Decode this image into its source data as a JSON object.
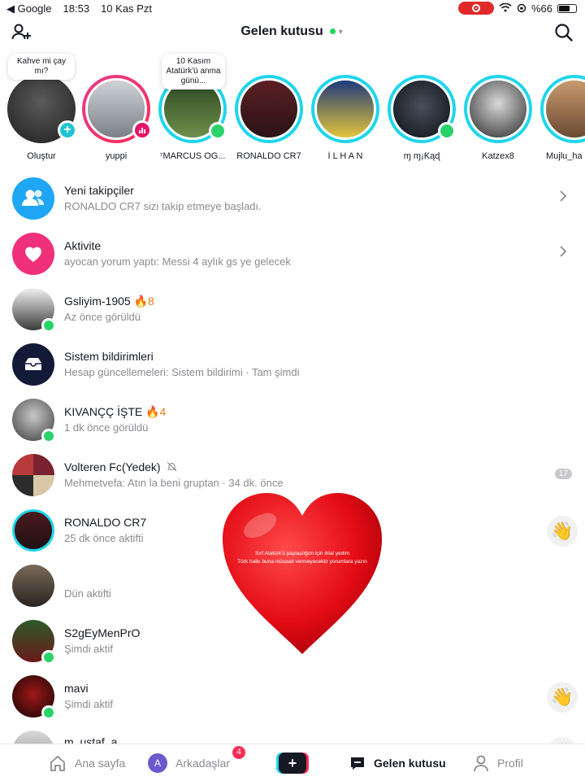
{
  "status_bar": {
    "back_app": "◀ Google",
    "time": "18:53",
    "date": "10 Kas Pzt",
    "battery_percent": "%66",
    "battery_level": 0.66
  },
  "header": {
    "title": "Gelen kutusu"
  },
  "stories": [
    {
      "name": "Oluştur",
      "bubble": "Kahve mi çay mı?",
      "badge": "plus",
      "ring": "none"
    },
    {
      "name": "yuppi",
      "badge": "music",
      "ring": "pink"
    },
    {
      "name": "⁷MARCUS OG...",
      "bubble": "10 Kasım Atatürk'ü anma günü...",
      "badge": "online",
      "ring": "cyan"
    },
    {
      "name": "RONALDO CR7",
      "ring": "cyan"
    },
    {
      "name": "İ L H A N",
      "ring": "cyan"
    },
    {
      "name": "ɱ ɱ¡Ƙąɖ",
      "badge": "online",
      "ring": "cyan"
    },
    {
      "name": "Katzex8",
      "ring": "cyan"
    },
    {
      "name": "Mujlu_ha",
      "ring": "cyan"
    }
  ],
  "messages": [
    {
      "title": "Yeni takipçiler",
      "subtitle": "RONALDO CR7 sizi takip etmeye başladı.",
      "icon": "users-icon",
      "trailing": "chevron"
    },
    {
      "title": "Aktivite",
      "subtitle": "ayocan yorum yaptı: Messi 4 aylık gs ye gelecek",
      "icon": "heart-icon",
      "trailing": "chevron"
    },
    {
      "title": "Gsliyim-1905",
      "streak": "8",
      "subtitle": "Az önce görüldü",
      "online": true
    },
    {
      "title": "Sistem bildirimleri",
      "subtitle": "Hesap güncellemeleri: Sistem bildirimi · Tam şimdi",
      "icon": "inbox-icon"
    },
    {
      "title": "KIVANÇÇ İŞTE",
      "streak": "4",
      "subtitle": "1 dk önce görüldü",
      "online": true
    },
    {
      "title": "Volteren Fc(Yedek)",
      "muted": true,
      "subtitle": "Mehmetvefa: Atın la beni gruptan · 34 dk. önce",
      "count": "17"
    },
    {
      "title": "RONALDO CR7",
      "subtitle": "25 dk önce aktifti",
      "trailing": "wave"
    },
    {
      "title": "",
      "subtitle": "Dün aktifti"
    },
    {
      "title": "S2gEyMenPrO",
      "subtitle": "Şimdi aktif",
      "online": true
    },
    {
      "title": "mavi",
      "subtitle": "Şimdi aktif",
      "online": true,
      "trailing": "wave"
    },
    {
      "title": "m_ustaf_a",
      "subtitle": "",
      "trailing": "wave"
    }
  ],
  "overlay": {
    "heart_text_line1": "Sırf Atatürk'ü paylaştığım için ihlal yedim",
    "heart_text_line2": "Türk halkı buna müsaait vermeyecektir yorumlara yazın"
  },
  "bottom_nav": {
    "home": "Ana sayfa",
    "friends": "Arkadaşlar",
    "friends_avatar": "A",
    "friends_badge": "4",
    "create": "+",
    "inbox": "Gelen kutusu",
    "profile": "Profil"
  },
  "colors": {
    "accent": "#fe2c55",
    "online": "#28d36a",
    "story_ring": "#20d5ec",
    "followers_icon_bg": "#1fa6f5",
    "activity_icon_bg": "#f0307a",
    "system_icon_bg": "#131a38"
  }
}
